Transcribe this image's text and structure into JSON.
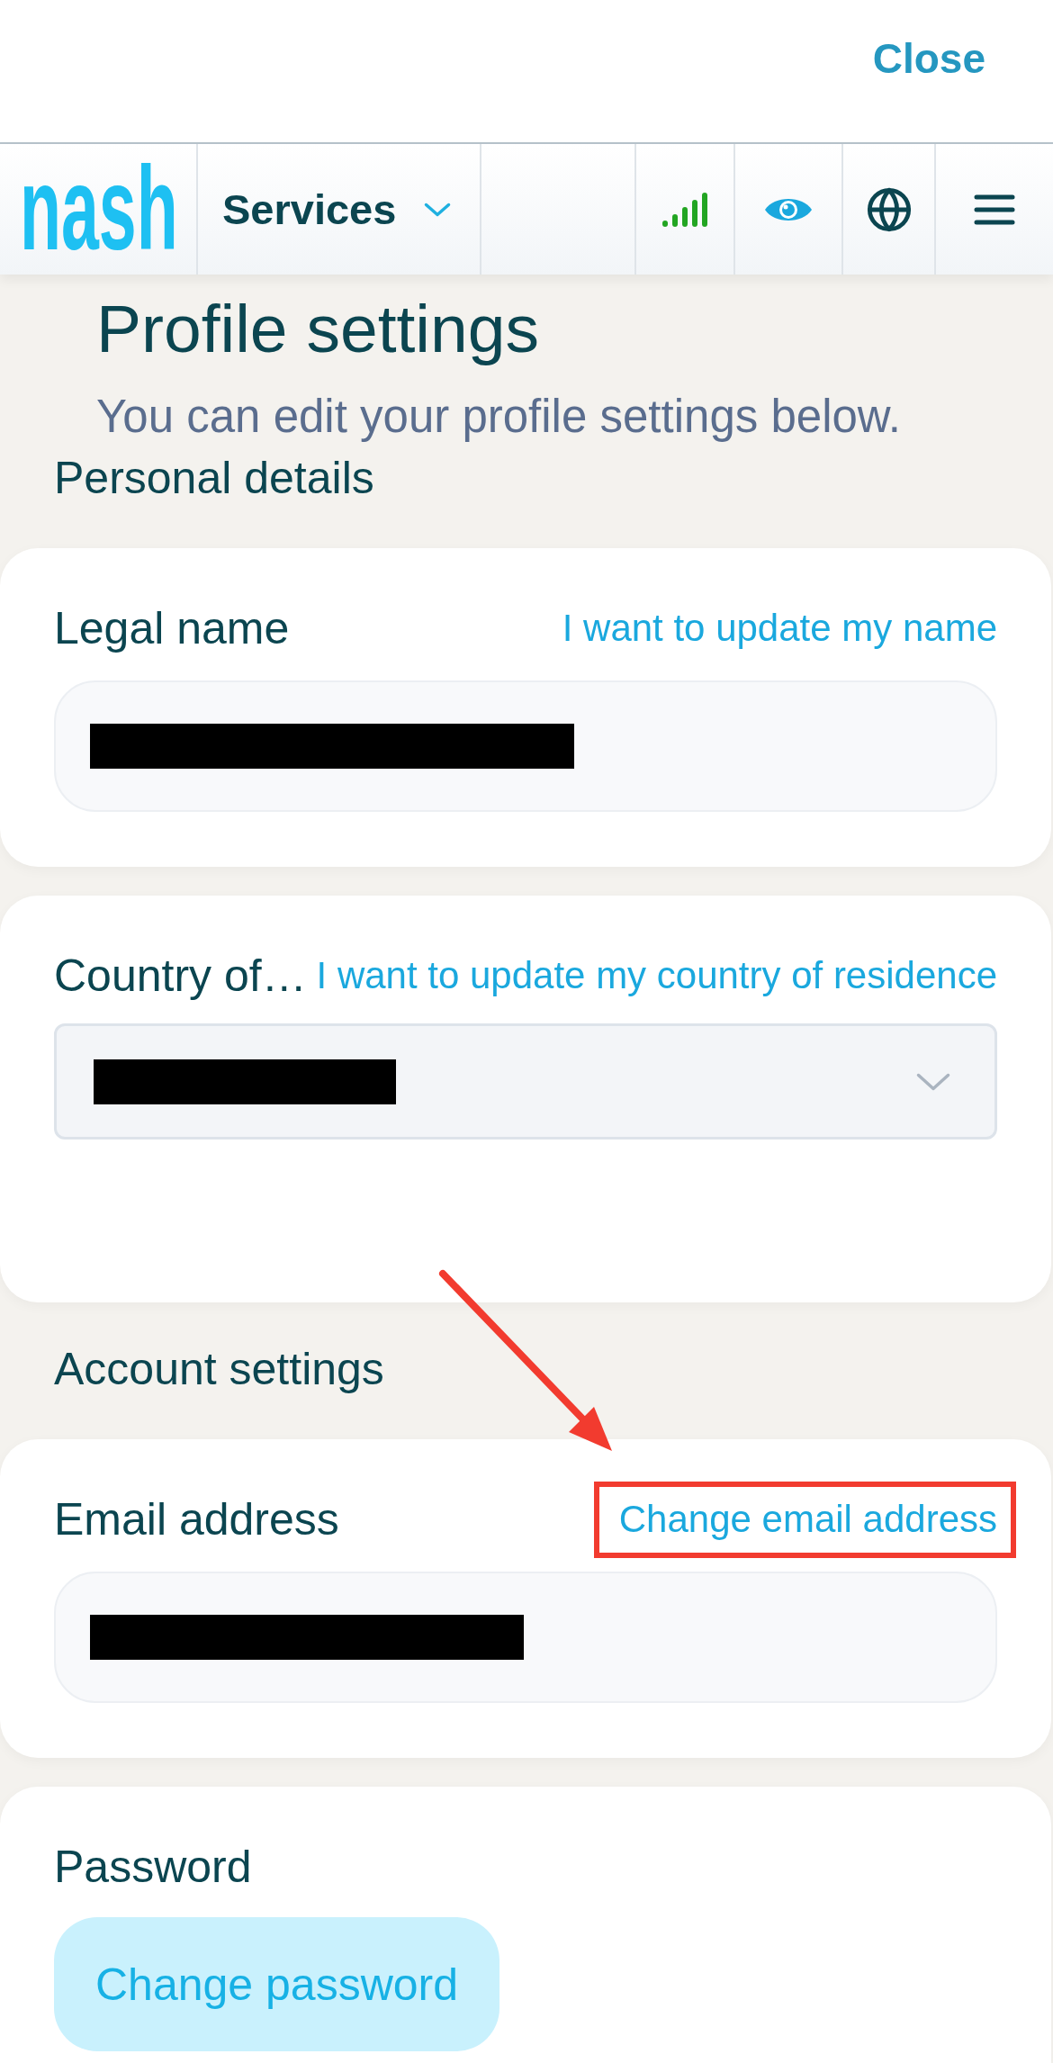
{
  "top_bar": {
    "close": "Close"
  },
  "nav": {
    "logo": "nash",
    "services": "Services"
  },
  "header": {
    "title": "Profile settings",
    "subtitle": "You can edit your profile settings below."
  },
  "sections": [
    {
      "heading": "Personal details",
      "cards": [
        {
          "kind": "text",
          "label": "Legal name",
          "link": {
            "text": "I want to update my name",
            "highlighted": false
          },
          "value_redacted": true
        },
        {
          "kind": "select",
          "label": "Country of…",
          "link": {
            "text": "I want to update my country of residence",
            "highlighted": false
          },
          "value_redacted": true
        }
      ]
    },
    {
      "heading": "Account settings",
      "cards": [
        {
          "kind": "text",
          "label": "Email address",
          "link": {
            "text": "Change email address",
            "highlighted": true
          },
          "value_redacted": true
        },
        {
          "kind": "button",
          "label": "Password",
          "button": "Change password"
        }
      ]
    }
  ]
}
